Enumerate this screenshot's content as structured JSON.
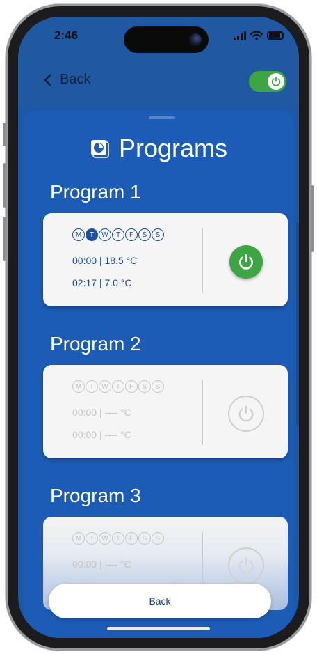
{
  "status_bar": {
    "time": "2:46"
  },
  "nav": {
    "back_label": "Back"
  },
  "header": {
    "title": "Programs"
  },
  "programs": [
    {
      "title": "Program 1",
      "days": [
        "M",
        "T",
        "W",
        "T",
        "F",
        "S",
        "S"
      ],
      "active_days": [
        1
      ],
      "line1": "00:00 | 18.5 °C",
      "line2": "02:17 | 7.0 °C",
      "enabled": true
    },
    {
      "title": "Program 2",
      "days": [
        "M",
        "T",
        "W",
        "T",
        "F",
        "S",
        "S"
      ],
      "active_days": [],
      "line1": "00:00 | ---- °C",
      "line2": "00:00 | ---- °C",
      "enabled": false
    },
    {
      "title": "Program 3",
      "days": [
        "M",
        "T",
        "W",
        "T",
        "F",
        "S",
        "S"
      ],
      "active_days": [],
      "line1": "00:00 | ---- °C",
      "line2": "",
      "enabled": false
    }
  ],
  "footer": {
    "back_button_label": "Back"
  },
  "colors": {
    "sheet": "#1c5cb6",
    "active_green": "#3da544",
    "text_blue": "#1f4f9a"
  },
  "icons": {
    "back": "chevron-left-icon",
    "power": "power-icon",
    "title": "clock-icon"
  }
}
